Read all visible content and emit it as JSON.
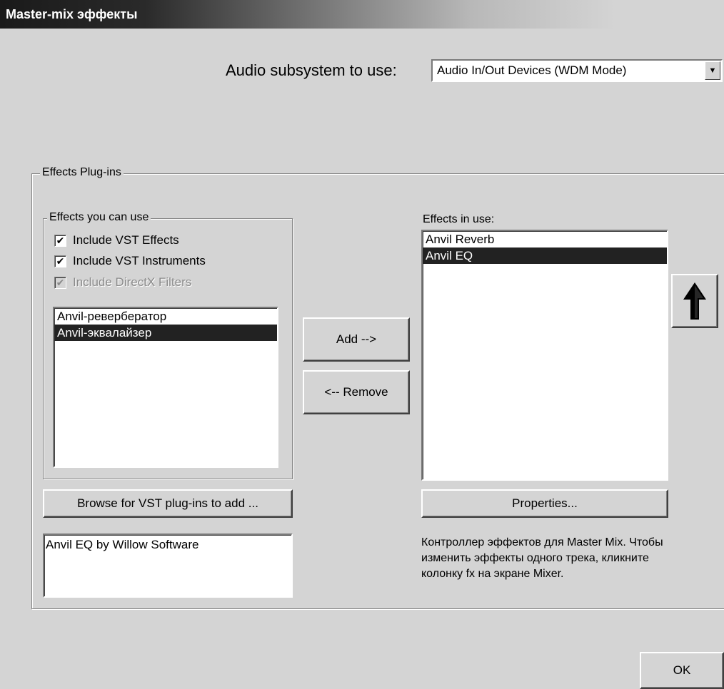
{
  "window": {
    "title": "Master-mix эффекты"
  },
  "audio": {
    "label": "Audio subsystem to use:",
    "selected": "Audio In/Out Devices (WDM Mode)",
    "arrow_icon": "chevron-down-icon"
  },
  "plugins_group": {
    "title": "Effects Plug-ins",
    "available": {
      "title": "Effects you can use",
      "checkboxes": [
        {
          "label": "Include VST Effects",
          "checked": true,
          "enabled": true
        },
        {
          "label": "Include VST Instruments",
          "checked": true,
          "enabled": true
        },
        {
          "label": "Include DirectX Filters",
          "checked": true,
          "enabled": false
        }
      ],
      "items": [
        "Anvil-ревербератор",
        "Anvil-эквалайзер"
      ],
      "selected_index": 1
    },
    "browse_label": "Browse for VST plug-ins to add ...",
    "description": "Anvil EQ by Willow Software",
    "add_label": "Add -->",
    "remove_label": "<-- Remove",
    "in_use": {
      "label": "Effects in use:",
      "items": [
        "Anvil Reverb",
        "Anvil EQ"
      ],
      "selected_index": 1
    },
    "properties_label": "Properties...",
    "move_up_icon": "arrow-up-icon",
    "hint": "Контроллер эффектов для Master Mix. Чтобы изменить эффекты одного трека, кликните колонку fx на экране Mixer."
  },
  "ok_label": "OK",
  "colors": {
    "dialog_bg": "#d4d4d4",
    "selection_bg": "#222222",
    "selection_fg": "#ffffff"
  }
}
